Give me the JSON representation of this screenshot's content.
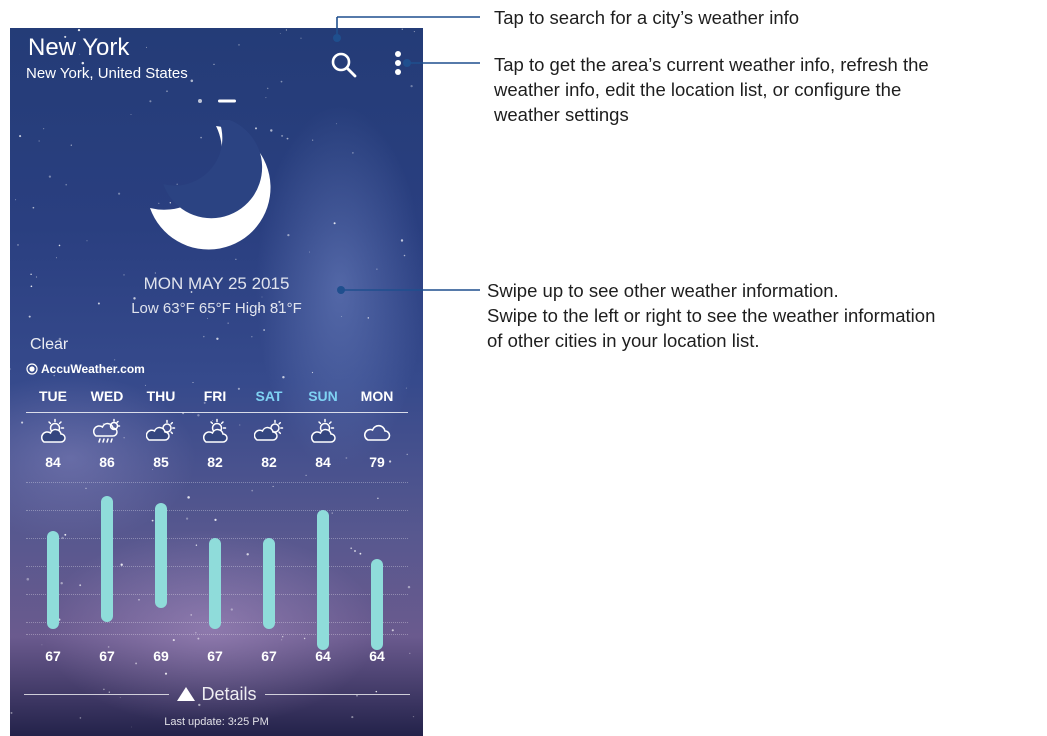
{
  "app": {
    "city": "New York",
    "region": "New York, United States",
    "date": "MON MAY 25 2015",
    "temps_line": "Low 63°F 65°F High 81°F",
    "condition": "Clear",
    "provider": "AccuWeather.com",
    "details_label": "Details",
    "last_update": "Last update: 3:25 PM"
  },
  "icons": {
    "search": "search-icon",
    "more": "more-vertical-icon",
    "current": "moon-icon",
    "provider": "sun-logo-icon"
  },
  "pager": {
    "pages": 2,
    "current": 2
  },
  "forecast": [
    {
      "day": "TUE",
      "weekend": false,
      "icon": "partly-sunny",
      "high": "84",
      "low": "67",
      "bar_min": 67,
      "bar_max": 81
    },
    {
      "day": "WED",
      "weekend": false,
      "icon": "sunny-rain",
      "high": "86",
      "low": "67",
      "bar_min": 68,
      "bar_max": 86
    },
    {
      "day": "THU",
      "weekend": false,
      "icon": "partly-cloudy",
      "high": "85",
      "low": "69",
      "bar_min": 70,
      "bar_max": 85
    },
    {
      "day": "FRI",
      "weekend": false,
      "icon": "partly-sunny",
      "high": "82",
      "low": "67",
      "bar_min": 67,
      "bar_max": 80
    },
    {
      "day": "SAT",
      "weekend": true,
      "icon": "partly-cloudy",
      "high": "82",
      "low": "67",
      "bar_min": 67,
      "bar_max": 80
    },
    {
      "day": "SUN",
      "weekend": true,
      "icon": "partly-sunny",
      "high": "84",
      "low": "64",
      "bar_min": 64,
      "bar_max": 84
    },
    {
      "day": "MON",
      "weekend": false,
      "icon": "cloudy",
      "high": "79",
      "low": "64",
      "bar_min": 64,
      "bar_max": 77
    }
  ],
  "colors": {
    "bar": "#8fdcda",
    "weekend": "#7fd2f3",
    "callout_line": "#1f4f8e"
  },
  "annotations": {
    "search": "Tap to search for a city’s weather info",
    "menu": [
      "Tap to get the area’s current weather info, refresh the",
      "weather info, edit the location list, or configure the",
      "weather settings"
    ],
    "swipe": [
      "Swipe up to see other weather information.",
      "Swipe to the left or right to see the weather information",
      "of other cities in your location list."
    ]
  }
}
